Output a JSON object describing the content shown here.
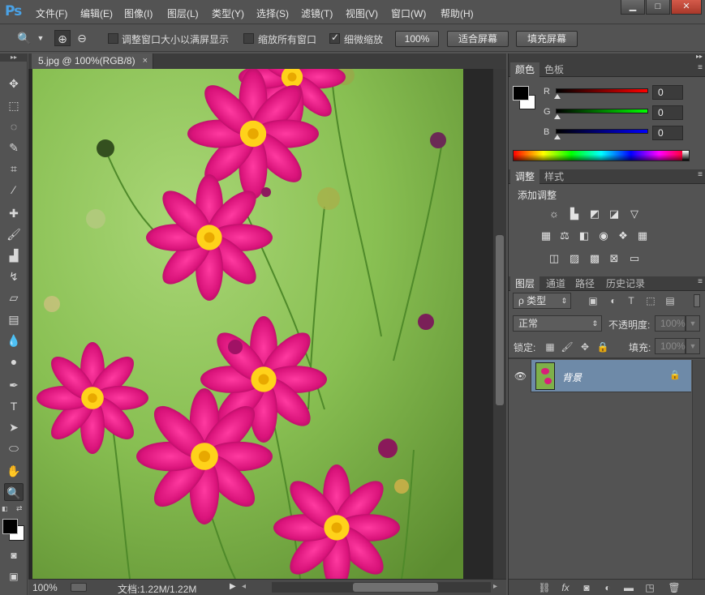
{
  "app": {
    "logo": "Ps"
  },
  "menu": [
    "文件(F)",
    "编辑(E)",
    "图像(I)",
    "图层(L)",
    "类型(Y)",
    "选择(S)",
    "滤镜(T)",
    "视图(V)",
    "窗口(W)",
    "帮助(H)"
  ],
  "window_controls": {
    "minimize": "▁",
    "maximize": "□",
    "close": "✕"
  },
  "options": {
    "resize_windows_label": "调整窗口大小以满屏显示",
    "resize_windows_checked": false,
    "zoom_all_label": "缩放所有窗口",
    "zoom_all_checked": false,
    "scrubby_zoom_label": "细微缩放",
    "scrubby_zoom_checked": true,
    "zoom_100_label": "100%",
    "fit_screen_label": "适合屏幕",
    "fill_screen_label": "填充屏幕"
  },
  "document": {
    "tab_title": "5.jpg @ 100%(RGB/8)",
    "tab_close": "×"
  },
  "status": {
    "zoom": "100%",
    "doc_info": "文档:1.22M/1.22M"
  },
  "color_panel": {
    "tabs": [
      "颜色",
      "色板"
    ],
    "r_label": "R",
    "g_label": "G",
    "b_label": "B",
    "r_value": "0",
    "g_value": "0",
    "b_value": "0"
  },
  "adjustments_panel": {
    "tabs": [
      "调整",
      "样式"
    ],
    "heading": "添加调整"
  },
  "layers_panel": {
    "tabs": [
      "图层",
      "通道",
      "路径",
      "历史记录"
    ],
    "filter_kind": "ρ 类型",
    "blend_mode": "正常",
    "opacity_label": "不透明度:",
    "opacity_value": "100%",
    "lock_label": "锁定:",
    "fill_label": "填充:",
    "fill_value": "100%",
    "layers": [
      {
        "name": "背景",
        "visible": true,
        "locked": true
      }
    ]
  },
  "colors": {
    "accent_blue": "#4aa2e6",
    "selected_layer": "#6e8aa8",
    "foreground": "#000000",
    "background": "#ffffff"
  },
  "icons": {
    "zoom_tool": "zoom-icon",
    "visibility": "eye-icon",
    "lock": "lock-icon"
  }
}
